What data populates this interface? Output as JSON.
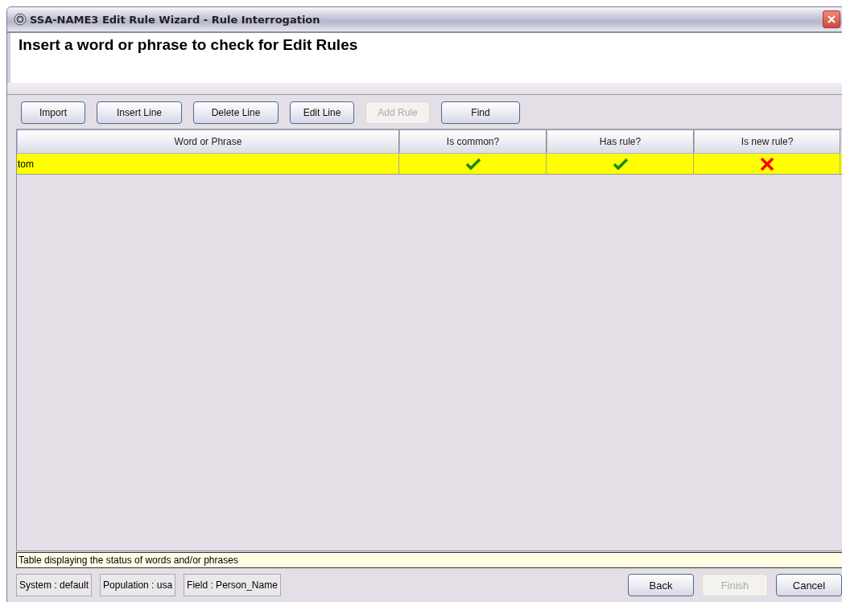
{
  "window": {
    "title": "SSA-NAME3 Edit Rule Wizard - Rule Interrogation"
  },
  "heading": "Insert a word or phrase to check for Edit Rules",
  "toolbar": [
    {
      "label": "Import",
      "disabled": false
    },
    {
      "label": "Insert Line",
      "disabled": false
    },
    {
      "label": "Delete Line",
      "disabled": false
    },
    {
      "label": "Edit Line",
      "disabled": false
    },
    {
      "label": "Add Rule",
      "disabled": true
    },
    {
      "label": "Find",
      "disabled": false
    }
  ],
  "table": {
    "columns": [
      "Word or Phrase",
      "Is common?",
      "Has rule?",
      "Is new rule?"
    ],
    "rows": [
      {
        "word": "tom",
        "selected": true,
        "is_common": true,
        "has_rule": true,
        "is_new_rule": false
      }
    ]
  },
  "description": "Table displaying the status of words and/or phrases",
  "status_bar": [
    "System : default",
    "Population : usa",
    "Field : Person_Name"
  ],
  "buttons": [
    {
      "label": "Back",
      "disabled": false
    },
    {
      "label": "Finish",
      "disabled": true
    },
    {
      "label": "Cancel",
      "disabled": false
    }
  ]
}
